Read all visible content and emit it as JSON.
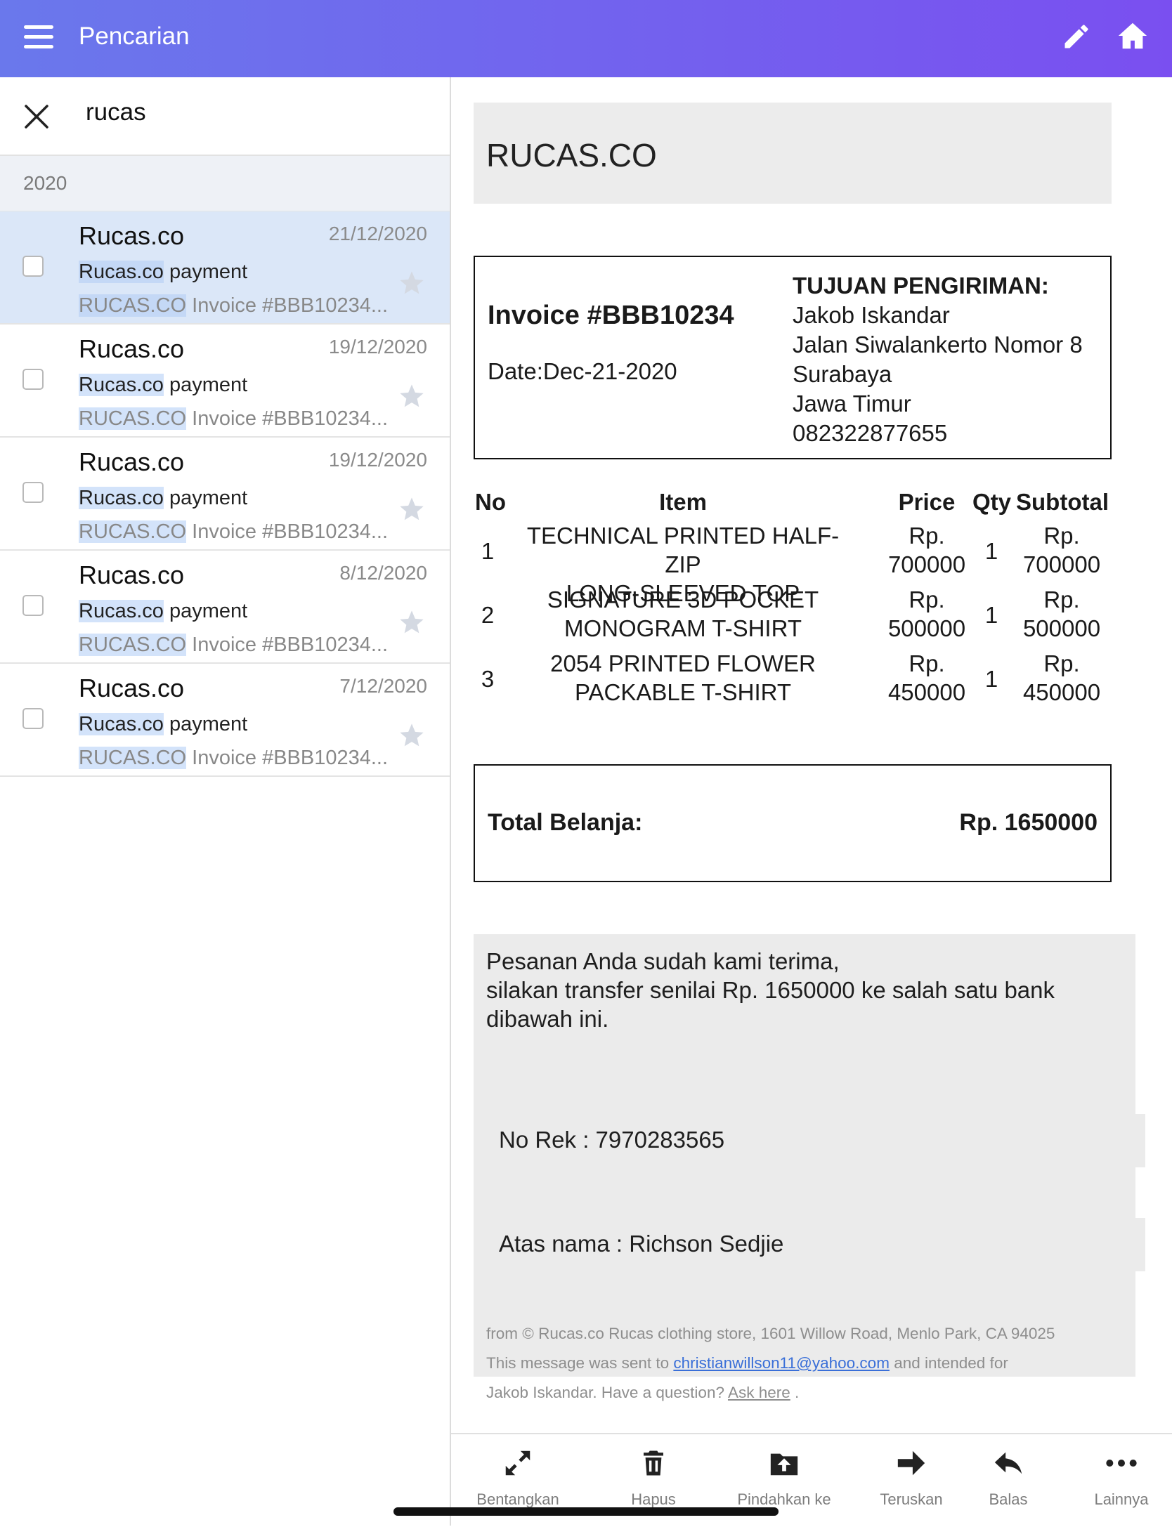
{
  "app": {
    "title": "Pencarian",
    "colors": {
      "header_gradient_start": "#6a78ec",
      "header_gradient_end": "#7a4ff0",
      "selected_row": "#dbe7f8",
      "highlight": "#d3e3fa"
    }
  },
  "search": {
    "query": "rucas"
  },
  "list": {
    "year_header": "2020",
    "items": [
      {
        "sender": "Rucas.co",
        "date": "21/12/2020",
        "subject_hl": "Rucas.co",
        "subject_rest": " payment",
        "preview_hl": "RUCAS.CO",
        "preview_rest": " Invoice #BBB10234...",
        "selected": true
      },
      {
        "sender": "Rucas.co",
        "date": "19/12/2020",
        "subject_hl": "Rucas.co",
        "subject_rest": " payment",
        "preview_hl": "RUCAS.CO",
        "preview_rest": " Invoice #BBB10234...",
        "selected": false
      },
      {
        "sender": "Rucas.co",
        "date": "19/12/2020",
        "subject_hl": "Rucas.co",
        "subject_rest": " payment",
        "preview_hl": "RUCAS.CO",
        "preview_rest": " Invoice #BBB10234...",
        "selected": false
      },
      {
        "sender": "Rucas.co",
        "date": "8/12/2020",
        "subject_hl": "Rucas.co",
        "subject_rest": " payment",
        "preview_hl": "RUCAS.CO",
        "preview_rest": " Invoice #BBB10234...",
        "selected": false
      },
      {
        "sender": "Rucas.co",
        "date": "7/12/2020",
        "subject_hl": "Rucas.co",
        "subject_rest": " payment",
        "preview_hl": "RUCAS.CO",
        "preview_rest": " Invoice #BBB10234...",
        "selected": false
      }
    ]
  },
  "email": {
    "brand": "RUCAS.CO",
    "invoice_number": "Invoice #BBB10234",
    "invoice_date": "Date:Dec-21-2020",
    "shipping": {
      "heading": "TUJUAN PENGIRIMAN:",
      "name": "Jakob Iskandar",
      "street": "Jalan Siwalankerto Nomor 8",
      "city": "Surabaya",
      "province": "Jawa Timur",
      "phone": "082322877655"
    },
    "table": {
      "headers": {
        "no": "No",
        "item": "Item",
        "price": "Price",
        "qty": "Qty",
        "subtotal": "Subtotal"
      },
      "rows": [
        {
          "no": "1",
          "item_line1": "TECHNICAL PRINTED HALF-ZIP",
          "item_line2": "LONG-SLEEVED TOP",
          "price_cur": "Rp.",
          "price_val": "700000",
          "qty": "1",
          "sub_cur": "Rp.",
          "sub_val": "700000"
        },
        {
          "no": "2",
          "item_line1": "SIGNATURE 3D POCKET",
          "item_line2": "MONOGRAM T-SHIRT",
          "price_cur": "Rp.",
          "price_val": "500000",
          "qty": "1",
          "sub_cur": "Rp.",
          "sub_val": "500000"
        },
        {
          "no": "3",
          "item_line1": "2054 PRINTED FLOWER",
          "item_line2": "PACKABLE T-SHIRT",
          "price_cur": "Rp.",
          "price_val": "450000",
          "qty": "1",
          "sub_cur": "Rp.",
          "sub_val": "450000"
        }
      ]
    },
    "total": {
      "label": "Total Belanja:",
      "value": "Rp. 1650000"
    },
    "message": {
      "line1": "Pesanan Anda sudah kami terima,",
      "line2": "silakan transfer senilai Rp. 1650000 ke salah satu bank",
      "line3": "dibawah ini.",
      "account": "No Rek : 7970283565",
      "holder": "Atas nama : Richson Sedjie"
    },
    "footer": {
      "line1": "from © Rucas.co Rucas clothing store, 1601 Willow Road, Menlo Park, CA 94025",
      "sent_prefix": "This message was sent to ",
      "email": "christianwillson11@yahoo.com",
      "sent_suffix": " and intended for",
      "line3_prefix": "Jakob Iskandar. Have a question? ",
      "ask_link": "Ask here",
      "line3_suffix": " ."
    }
  },
  "toolbar": {
    "expand": "Bentangkan",
    "delete": "Hapus",
    "move": "Pindahkan ke",
    "forward": "Teruskan",
    "reply": "Balas",
    "more": "Lainnya"
  }
}
